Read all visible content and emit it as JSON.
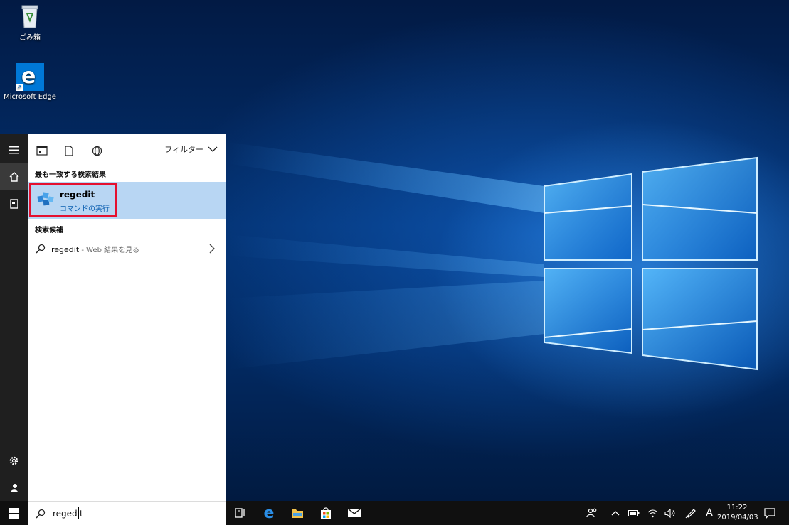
{
  "desktop": {
    "icons": [
      {
        "label": "ごみ箱",
        "icon": "recycle-bin-icon"
      },
      {
        "label": "Microsoft Edge",
        "icon": "edge-icon"
      }
    ]
  },
  "start_menu": {
    "rail": [
      "menu-icon",
      "home-icon",
      "documents-icon",
      "settings-icon",
      "user-icon"
    ],
    "toolbar": {
      "icons": [
        "apps-filter-icon",
        "document-filter-icon",
        "web-filter-icon"
      ],
      "filter_label": "フィルター"
    },
    "best_match": {
      "section_title": "最も一致する検索結果",
      "name": "regedit",
      "type": "コマンドの実行",
      "highlight_color": "#e5102f"
    },
    "suggestions": {
      "section_title": "検索候補",
      "items": [
        {
          "text": "regedit",
          "sub": " - Web 結果を見る"
        }
      ]
    }
  },
  "search": {
    "value": "regedit"
  },
  "taskbar": {
    "apps": [
      "task-view-icon",
      "edge-icon",
      "file-explorer-icon",
      "store-icon",
      "mail-icon"
    ],
    "tray": [
      "people-icon",
      "chevron-up-icon",
      "battery-icon",
      "wifi-icon",
      "volume-icon",
      "pen-icon"
    ],
    "ime": "A",
    "time": "11:22",
    "date": "2019/04/03"
  },
  "colors": {
    "accent": "#0078d7",
    "selected_row": "#b8d6f3",
    "taskbar": "#101010"
  }
}
